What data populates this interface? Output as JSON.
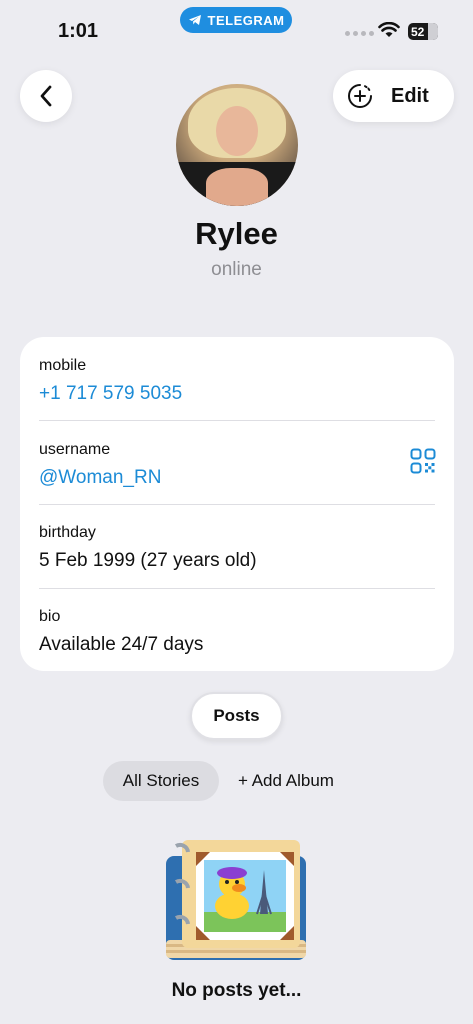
{
  "status_bar": {
    "time": "1:01",
    "app_pill": "TELEGRAM",
    "battery": "52"
  },
  "header": {
    "back_icon": "chevron-left-icon",
    "add_story_icon": "add-circle-icon",
    "edit_label": "Edit"
  },
  "profile": {
    "name": "Rylee",
    "status": "online"
  },
  "info": {
    "mobile_label": "mobile",
    "mobile_value": "+1 717 579 5035",
    "username_label": "username",
    "username_value": "@Woman_RN",
    "birthday_label": "birthday",
    "birthday_value": "5 Feb 1999 (27 years old)",
    "bio_label": "bio",
    "bio_value": "Available 24/7 days"
  },
  "tabs": {
    "posts_label": "Posts"
  },
  "albums": {
    "all_stories_label": "All Stories",
    "add_album_label": "+ Add Album"
  },
  "empty_state": {
    "text": "No posts yet..."
  },
  "colors": {
    "background": "#ececf1",
    "link": "#1c8bd6",
    "telegram_pill": "#1f8ee0"
  }
}
